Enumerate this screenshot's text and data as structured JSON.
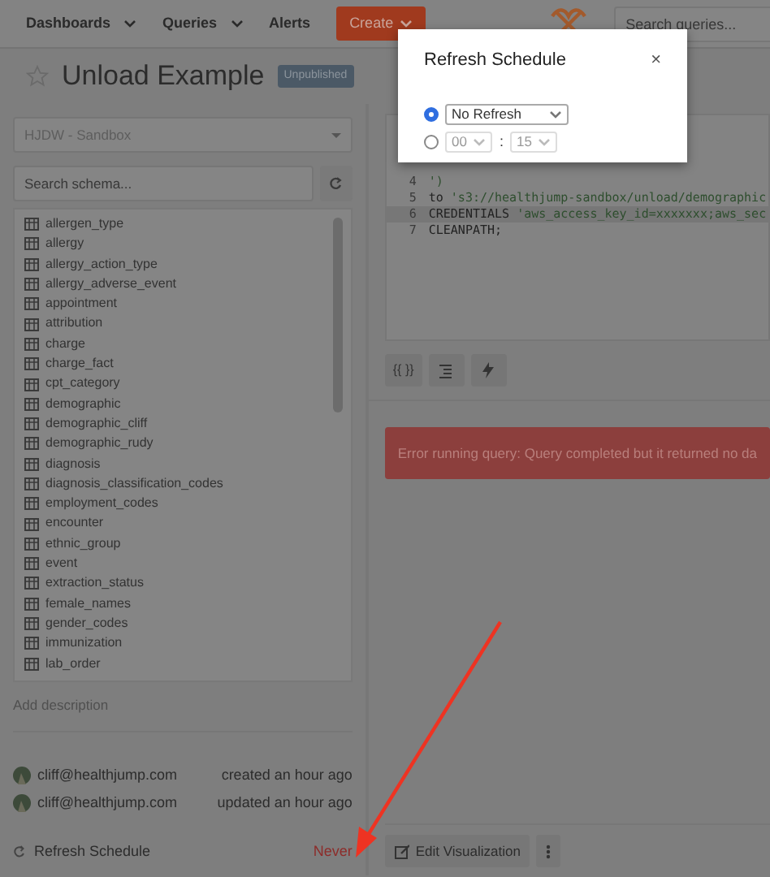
{
  "navbar": {
    "items": [
      {
        "label": "Dashboards",
        "dropdown": true
      },
      {
        "label": "Queries",
        "dropdown": true
      },
      {
        "label": "Alerts",
        "dropdown": false
      }
    ],
    "create_button": "Create",
    "search": {
      "placeholder": "Search queries..."
    }
  },
  "query": {
    "title": "Unload Example",
    "favorite": false,
    "badge": "Unpublished"
  },
  "schema": {
    "data_source": "HJDW - Sandbox",
    "search": {
      "placeholder": "Search schema..."
    },
    "tables": [
      "allergen_type",
      "allergy",
      "allergy_action_type",
      "allergy_adverse_event",
      "appointment",
      "attribution",
      "charge",
      "charge_fact",
      "cpt_category",
      "demographic",
      "demographic_cliff",
      "demographic_rudy",
      "diagnosis",
      "diagnosis_classification_codes",
      "employment_codes",
      "encounter",
      "ethnic_group",
      "event",
      "extraction_status",
      "female_names",
      "gender_codes",
      "immunization",
      "lab_order"
    ]
  },
  "description": {
    "placeholder": "Add description"
  },
  "history": [
    {
      "user": "cliff@healthjump.com",
      "action": "created an hour ago"
    },
    {
      "user": "cliff@healthjump.com",
      "action": "updated an hour ago"
    }
  ],
  "refresh": {
    "label": "Refresh Schedule",
    "value": "Never"
  },
  "editor": {
    "lines": [
      {
        "number": "4",
        "highlighted": false,
        "tokens": [
          {
            "kind": "string",
            "text": "')"
          }
        ]
      },
      {
        "number": "5",
        "highlighted": false,
        "tokens": [
          {
            "kind": "keyword",
            "text": "to "
          },
          {
            "kind": "string",
            "text": "'s3://healthjump-sandbox/unload/demographic"
          }
        ]
      },
      {
        "number": "6",
        "highlighted": true,
        "tokens": [
          {
            "kind": "keyword",
            "text": "CREDENTIALS "
          },
          {
            "kind": "string",
            "text": "'aws_access_key_id=xxxxxxx;aws_sec"
          }
        ]
      },
      {
        "number": "7",
        "highlighted": false,
        "tokens": [
          {
            "kind": "keyword",
            "text": "CLEANPATH;"
          }
        ]
      }
    ]
  },
  "toolbar": {
    "params_button": "{{ }}"
  },
  "error": {
    "prefix": "Error running query: ",
    "message": "Query completed but it returned no da"
  },
  "edit_visualization": "Edit Visualization",
  "modal": {
    "title": "Refresh Schedule",
    "close": "×",
    "options": [
      {
        "kind": "interval",
        "selected": true,
        "value": "No Refresh"
      },
      {
        "kind": "time",
        "selected": false,
        "hour": "00",
        "separator": ":",
        "minute": "15"
      }
    ]
  }
}
